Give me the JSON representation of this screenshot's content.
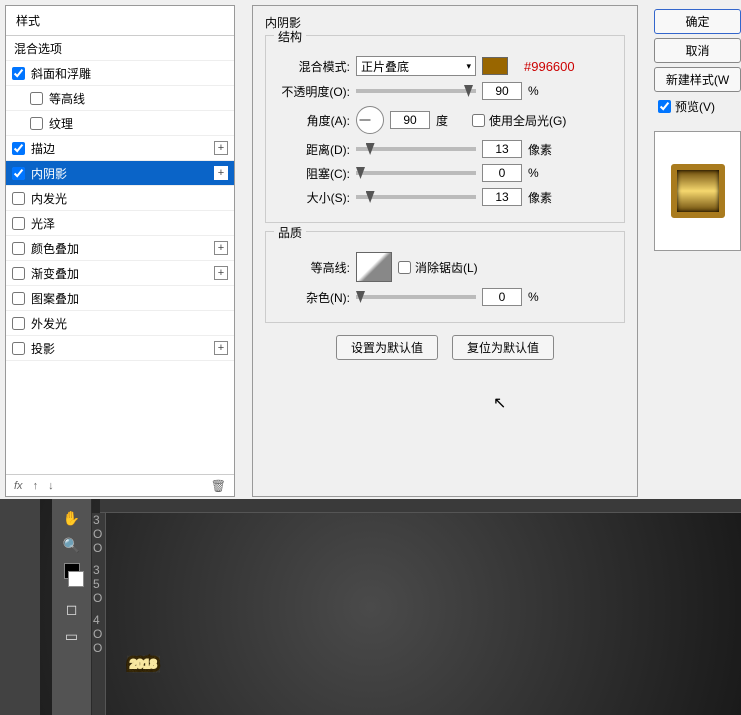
{
  "left": {
    "header": "样式",
    "items": [
      {
        "label": "混合选项",
        "indent": false,
        "checked": false,
        "hasPlus": false,
        "noCheckbox": true
      },
      {
        "label": "斜面和浮雕",
        "indent": false,
        "checked": true,
        "hasPlus": false
      },
      {
        "label": "等高线",
        "indent": true,
        "checked": false,
        "hasPlus": false
      },
      {
        "label": "纹理",
        "indent": true,
        "checked": false,
        "hasPlus": false
      },
      {
        "label": "描边",
        "indent": false,
        "checked": true,
        "hasPlus": true
      },
      {
        "label": "内阴影",
        "indent": false,
        "checked": true,
        "hasPlus": true,
        "selected": true
      },
      {
        "label": "内发光",
        "indent": false,
        "checked": false,
        "hasPlus": false
      },
      {
        "label": "光泽",
        "indent": false,
        "checked": false,
        "hasPlus": false
      },
      {
        "label": "颜色叠加",
        "indent": false,
        "checked": false,
        "hasPlus": true
      },
      {
        "label": "渐变叠加",
        "indent": false,
        "checked": false,
        "hasPlus": true
      },
      {
        "label": "图案叠加",
        "indent": false,
        "checked": false,
        "hasPlus": false
      },
      {
        "label": "外发光",
        "indent": false,
        "checked": false,
        "hasPlus": false
      },
      {
        "label": "投影",
        "indent": false,
        "checked": false,
        "hasPlus": true
      }
    ],
    "footer": {
      "fx": "fx"
    }
  },
  "mid": {
    "title": "内阴影",
    "structure": {
      "title": "结构",
      "blendMode": {
        "label": "混合模式:",
        "value": "正片叠底",
        "hex": "#996600"
      },
      "opacity": {
        "label": "不透明度(O):",
        "value": "90",
        "unit": "%"
      },
      "angle": {
        "label": "角度(A):",
        "value": "90",
        "unit": "度",
        "globalLabel": "使用全局光(G)",
        "globalChecked": false
      },
      "distance": {
        "label": "距离(D):",
        "value": "13",
        "unit": "像素"
      },
      "choke": {
        "label": "阻塞(C):",
        "value": "0",
        "unit": "%"
      },
      "size": {
        "label": "大小(S):",
        "value": "13",
        "unit": "像素"
      }
    },
    "quality": {
      "title": "品质",
      "contour": {
        "label": "等高线:",
        "antiAlias": "消除锯齿(L)"
      },
      "noise": {
        "label": "杂色(N):",
        "value": "0",
        "unit": "%"
      }
    },
    "buttons": {
      "setDefault": "设置为默认值",
      "resetDefault": "复位为默认值"
    }
  },
  "right": {
    "ok": "确定",
    "cancel": "取消",
    "newStyle": "新建样式(W",
    "preview": "预览(V)"
  },
  "canvas": {
    "text": "2018",
    "rulerMarks": [
      "3 O O",
      "3 5 O",
      "4 O O"
    ]
  }
}
